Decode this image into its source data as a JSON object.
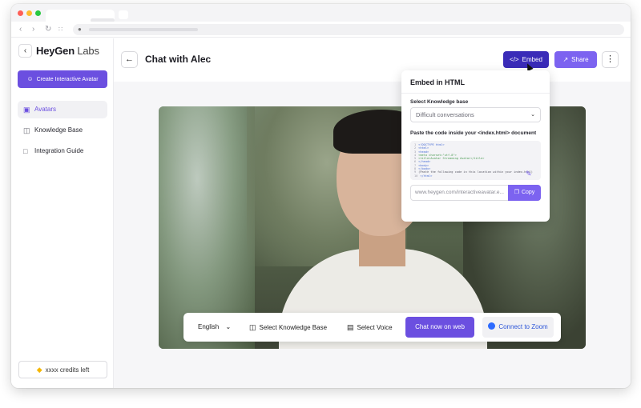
{
  "colors": {
    "accent": "#6b4fe0",
    "embed_bg": "#3a2bb8",
    "share_bg": "#7c63f0",
    "zoom_text": "#2d56d8",
    "credits_icon": "#f5b700"
  },
  "browser": {
    "tab_title": "",
    "url": ""
  },
  "sidebar": {
    "logo_main": "HeyGen",
    "logo_suffix": "Labs",
    "create_label": "Create Interactive Avatar",
    "items": [
      {
        "label": "Avatars",
        "icon": "avatar-icon",
        "active": true
      },
      {
        "label": "Knowledge Base",
        "icon": "box-icon",
        "active": false
      },
      {
        "label": "Integration Guide",
        "icon": "code-icon",
        "active": false
      }
    ],
    "credits": "xxxx credits left"
  },
  "header": {
    "title": "Chat with Alec",
    "embed_label": "Embed",
    "share_label": "Share"
  },
  "popover": {
    "title": "Embed in HTML",
    "kb_label": "Select Knowledge base",
    "kb_value": "Difficult conversations",
    "code_label": "Paste the code inside your <index.html> document",
    "code_lines": [
      "<!DOCTYPE html>",
      "<html>",
      "<head>",
      "<meta charset=\"utf-8\">",
      "<title>Avatar Streaming Avatar</title>",
      "</head>",
      "<body>",
      "</body>",
      "(Paste the following code in this location within your index.html)",
      "</html>"
    ],
    "url_value": "www.heygen.com/interactiveavatar.e...",
    "copy_label": "Copy"
  },
  "controls": {
    "language": "English",
    "knowledge_base": "Select Knowledge Base",
    "voice": "Select Voice",
    "chat_label": "Chat now on web",
    "zoom_label": "Connect to Zoom"
  }
}
